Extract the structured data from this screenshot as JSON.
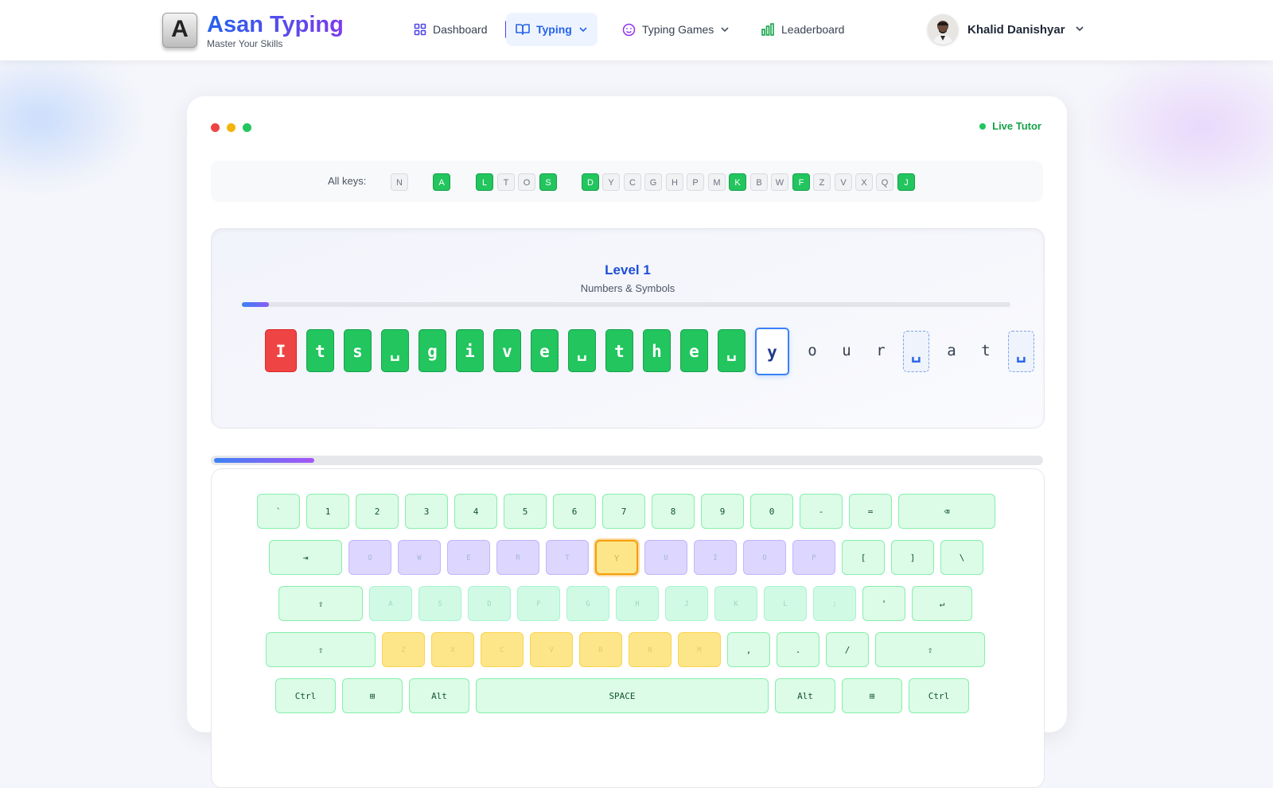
{
  "header": {
    "logo_letter": "A",
    "brand": "Asan Typing",
    "tagline": "Master Your Skills",
    "nav": [
      {
        "label": "Dashboard",
        "icon": "grid-icon"
      },
      {
        "label": "Typing",
        "icon": "book-icon",
        "active": true
      },
      {
        "label": "Typing Games",
        "icon": "smiley-icon"
      },
      {
        "label": "Leaderboard",
        "icon": "bar-chart-icon"
      }
    ],
    "user_name": "Khalid Danishyar"
  },
  "tutor": {
    "status": "Live Tutor",
    "all_keys_label": "All keys:",
    "keys": [
      {
        "k": "N",
        "on": false
      },
      {
        "k": "A",
        "on": true
      },
      {
        "k": "L",
        "on": true
      },
      {
        "k": "T",
        "on": false
      },
      {
        "k": "O",
        "on": false
      },
      {
        "k": "S",
        "on": true
      },
      {
        "k": "D",
        "on": true
      },
      {
        "k": "Y",
        "on": false
      },
      {
        "k": "C",
        "on": false
      },
      {
        "k": "G",
        "on": false
      },
      {
        "k": "H",
        "on": false
      },
      {
        "k": "P",
        "on": false
      },
      {
        "k": "M",
        "on": false
      },
      {
        "k": "K",
        "on": true
      },
      {
        "k": "B",
        "on": false
      },
      {
        "k": "W",
        "on": false
      },
      {
        "k": "F",
        "on": true
      },
      {
        "k": "Z",
        "on": false
      },
      {
        "k": "V",
        "on": false
      },
      {
        "k": "X",
        "on": false
      },
      {
        "k": "Q",
        "on": false
      },
      {
        "k": "J",
        "on": true
      }
    ]
  },
  "lesson": {
    "level": "Level 1",
    "subtitle": "Numbers & Symbols",
    "progress": 0.035,
    "chars": [
      {
        "c": "I",
        "s": "wrong"
      },
      {
        "c": "t",
        "s": "correct"
      },
      {
        "c": "s",
        "s": "correct"
      },
      {
        "c": "␣",
        "s": "correct"
      },
      {
        "c": "g",
        "s": "correct"
      },
      {
        "c": "i",
        "s": "correct"
      },
      {
        "c": "v",
        "s": "correct"
      },
      {
        "c": "e",
        "s": "correct"
      },
      {
        "c": "␣",
        "s": "correct"
      },
      {
        "c": "t",
        "s": "correct"
      },
      {
        "c": "h",
        "s": "correct"
      },
      {
        "c": "e",
        "s": "correct"
      },
      {
        "c": "␣",
        "s": "correct"
      },
      {
        "c": "y",
        "s": "current"
      },
      {
        "c": "o",
        "s": "pending"
      },
      {
        "c": "u",
        "s": "pending"
      },
      {
        "c": "r",
        "s": "pending"
      },
      {
        "c": "␣",
        "s": "space"
      },
      {
        "c": "a",
        "s": "pending"
      },
      {
        "c": "t",
        "s": "pending"
      },
      {
        "c": "␣",
        "s": "space"
      },
      {
        "c": "]",
        "s": "pending"
      }
    ]
  },
  "keyboard": {
    "progress": 0.12,
    "rows": [
      [
        "`",
        "1",
        "2",
        "3",
        "4",
        "5",
        "6",
        "7",
        "8",
        "9",
        "0",
        "-",
        "=",
        "⌫"
      ],
      [
        "⇥",
        "Q",
        "W",
        "E",
        "R",
        "T",
        "Y",
        "U",
        "I",
        "O",
        "P",
        "[",
        "]",
        "\\"
      ],
      [
        "⇪",
        "A",
        "S",
        "D",
        "F",
        "G",
        "H",
        "J",
        "K",
        "L",
        ";",
        "'",
        "↵"
      ],
      [
        "⇧",
        "Z",
        "X",
        "C",
        "V",
        "B",
        "N",
        "M",
        ",",
        ".",
        "/",
        "⇧"
      ],
      [
        "Ctrl",
        "⊞",
        "Alt",
        "SPACE",
        "Alt",
        "⊞",
        "Ctrl"
      ]
    ],
    "highlight": "Y"
  }
}
